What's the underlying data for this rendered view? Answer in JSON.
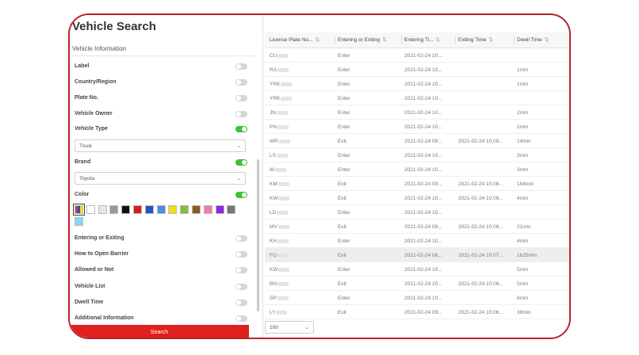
{
  "panel": {
    "title": "Vehicle Search",
    "subtitle": "Vehicle Information",
    "search_label": "Search"
  },
  "filters": [
    {
      "label": "Label",
      "on": false
    },
    {
      "label": "Country/Region",
      "on": false
    },
    {
      "label": "Plate No.",
      "on": false
    },
    {
      "label": "Vehicle Owner",
      "on": false
    },
    {
      "label": "Vehicle Type",
      "on": true
    },
    {
      "label": "Brand",
      "on": true
    },
    {
      "label": "Color",
      "on": true
    },
    {
      "label": "Entering or Exiting",
      "on": false
    },
    {
      "label": "How to Open Barrier",
      "on": false
    },
    {
      "label": "Allowed or Not",
      "on": false
    },
    {
      "label": "Vehicle List",
      "on": false
    },
    {
      "label": "Dwell Time",
      "on": false
    },
    {
      "label": "Additional Information",
      "on": false
    }
  ],
  "vehicle_type_value": "Truck",
  "brand_value": "Toyota",
  "colors": [
    "#e23b2b",
    "#ffffff",
    "#e6e6e6",
    "#999999",
    "#111111",
    "#d71d1d",
    "#2056c8",
    "#4b8de0",
    "#f2dc1b",
    "#7dc13a",
    "#8b5a2b",
    "#f07aa8",
    "#8a2be2",
    "#777777",
    "#86d6f0"
  ],
  "table": {
    "headers": [
      "License Plate Nu...",
      "Entering or Exiting",
      "Entering Ti...",
      "Exiting Time",
      "Dwell Time"
    ],
    "rows": [
      {
        "plate": "CU",
        "dir": "Enter",
        "enter": "2021-02-24 10...",
        "exit": "",
        "dwell": ""
      },
      {
        "plate": "RA",
        "dir": "Enter",
        "enter": "2021-02-24 10...",
        "exit": "",
        "dwell": "1min"
      },
      {
        "plate": "YRK",
        "dir": "Enter",
        "enter": "2021-02-24 10...",
        "exit": "",
        "dwell": "1min"
      },
      {
        "plate": "YRK",
        "dir": "Enter",
        "enter": "2021-02-24 10...",
        "exit": "",
        "dwell": ""
      },
      {
        "plate": "JN",
        "dir": "Enter",
        "enter": "2021-02-24 10...",
        "exit": "",
        "dwell": "2min"
      },
      {
        "plate": "PN",
        "dir": "Enter",
        "enter": "2021-02-24 10...",
        "exit": "",
        "dwell": "2min"
      },
      {
        "plate": "WR",
        "dir": "Exit",
        "enter": "2021-02-24 09...",
        "exit": "2021-02-24 10:09...",
        "dwell": "14min"
      },
      {
        "plate": "LS",
        "dir": "Enter",
        "enter": "2021-02-24 10...",
        "exit": "",
        "dwell": "3min"
      },
      {
        "plate": "W",
        "dir": "Enter",
        "enter": "2021-02-24 10...",
        "exit": "",
        "dwell": "3min"
      },
      {
        "plate": "KM",
        "dir": "Exit",
        "enter": "2021-02-24 09...",
        "exit": "2021-02-24 10:08...",
        "dwell": "1h4min"
      },
      {
        "plate": "KW",
        "dir": "Exit",
        "enter": "2021-02-24 10...",
        "exit": "2021-02-24 10:08...",
        "dwell": "4min"
      },
      {
        "plate": "LD",
        "dir": "Enter",
        "enter": "2021-02-24 10...",
        "exit": "",
        "dwell": ""
      },
      {
        "plate": "MV",
        "dir": "Exit",
        "enter": "2021-02-24 09...",
        "exit": "2021-02-24 10:08...",
        "dwell": "21min"
      },
      {
        "plate": "KH",
        "dir": "Enter",
        "enter": "2021-02-24 10...",
        "exit": "",
        "dwell": "4min"
      },
      {
        "plate": "FG",
        "dir": "Exit",
        "enter": "2021-02-24 08...",
        "exit": "2021-02-24 10:07...",
        "dwell": "1h25min"
      },
      {
        "plate": "KW",
        "dir": "Enter",
        "enter": "2021-02-24 10...",
        "exit": "",
        "dwell": "5min"
      },
      {
        "plate": "BN",
        "dir": "Exit",
        "enter": "2021-02-24 10...",
        "exit": "2021-02-24 10:06...",
        "dwell": "5min"
      },
      {
        "plate": "SP",
        "dir": "Enter",
        "enter": "2021-02-24 10...",
        "exit": "",
        "dwell": "6min"
      },
      {
        "plate": "LY",
        "dir": "Exit",
        "enter": "2021-02-24 09...",
        "exit": "2021-02-24 10:06...",
        "dwell": "36min"
      }
    ],
    "highlighted_row": 14
  },
  "pager": {
    "page_size": "100"
  }
}
